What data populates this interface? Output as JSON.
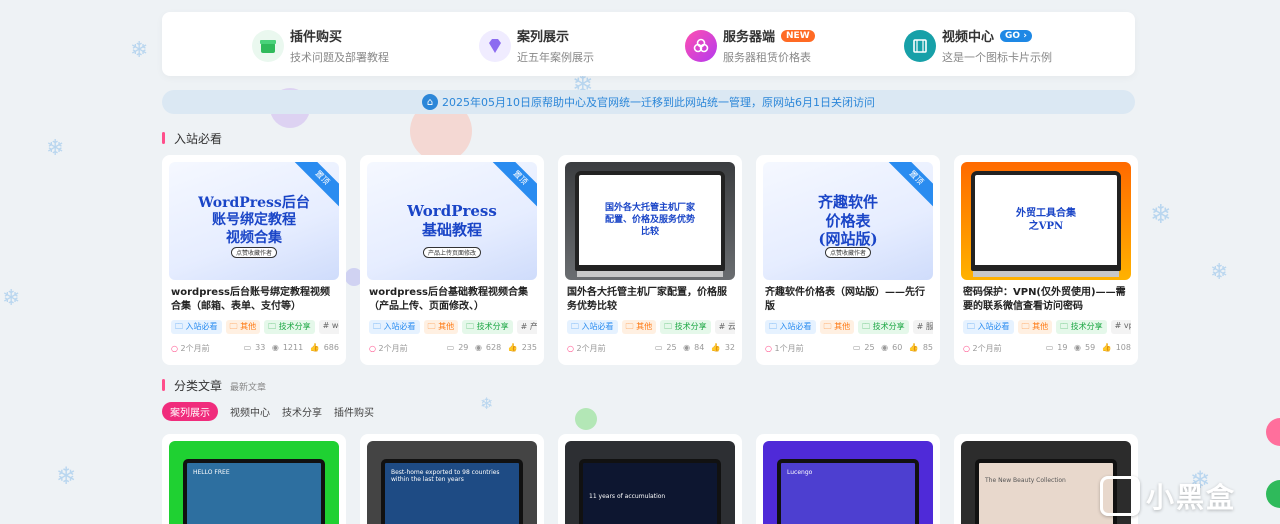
{
  "categories": [
    {
      "title": "插件购买",
      "subtitle": "技术问题及部署教程",
      "icon": "shop-icon",
      "color": "#2fba5b",
      "badge": ""
    },
    {
      "title": "案列展示",
      "subtitle": "近五年案例展示",
      "icon": "gem-icon",
      "color": "#8c6cf0",
      "badge": ""
    },
    {
      "title": "服务器端",
      "subtitle": "服务器租赁价格表",
      "icon": "cloud-icon",
      "color": "#e83ad0",
      "badge": "NEW"
    },
    {
      "title": "视频中心",
      "subtitle": "这是一个图标卡片示例",
      "icon": "film-icon",
      "color": "#17a0a8",
      "badge": "GO"
    }
  ],
  "notice": {
    "text": "2025年05月10日原帮助中心及官网统一迁移到此网站统一管理，原网站6月1日关闭访问"
  },
  "section_must_read": {
    "title": "入站必看"
  },
  "cards": [
    {
      "thumb_text": "WordPress后台\n账号绑定教程\n视频合集",
      "thumb_small": "点赞收藏作者",
      "ribbon": "置顶",
      "title": "wordpress后台账号绑定教程视频合集（邮箱、表单、支付等）",
      "tags": [
        "入站必看",
        "其他",
        "技术分享",
        "# wo"
      ],
      "time": "2个月前",
      "comments": "33",
      "views": "1211",
      "likes": "686"
    },
    {
      "thumb_text": "WordPress\n基础教程",
      "thumb_small": "产品上传页面修改",
      "ribbon": "置顶",
      "title": "wordpress后台基础教程视频合集（产品上传、页面修改、）",
      "tags": [
        "入站必看",
        "其他",
        "技术分享",
        "# 产品"
      ],
      "time": "2个月前",
      "comments": "29",
      "views": "628",
      "likes": "235"
    },
    {
      "thumb_text": "国外各大托管主机厂家\n配置、价格及服务优势\n比较",
      "thumb_small": "",
      "ribbon": "",
      "title": "国外各大托管主机厂家配置，价格服务优势比较",
      "tags": [
        "入站必看",
        "其他",
        "技术分享",
        "# 云"
      ],
      "time": "2个月前",
      "comments": "25",
      "views": "84",
      "likes": "32"
    },
    {
      "thumb_text": "齐趣软件\n价格表\n(网站版)",
      "thumb_small": "点赞收藏作者",
      "ribbon": "置顶",
      "title": "齐趣软件价格表（网站版）——先行版",
      "tags": [
        "入站必看",
        "其他",
        "技术分享",
        "# 服务"
      ],
      "time": "1个月前",
      "comments": "25",
      "views": "60",
      "likes": "85"
    },
    {
      "thumb_text": "外贸工具合集\n之VPN",
      "thumb_small": "",
      "ribbon": "",
      "title": "密码保护：VPN(仅外贸使用)——需要的联系微信查看访问密码",
      "tags": [
        "入站必看",
        "其他",
        "技术分享",
        "# vpn"
      ],
      "time": "2个月前",
      "comments": "19",
      "views": "59",
      "likes": "108"
    }
  ],
  "section_category": {
    "title": "分类文章",
    "subtitle": "最新文章"
  },
  "tabs": [
    "案列展示",
    "视频中心",
    "技术分享",
    "插件购买"
  ],
  "bottom_cards": [
    {
      "screen_text": "HELLO FREE",
      "bg": "#1fd132",
      "screen": "#2d6fa0"
    },
    {
      "screen_text": "Best-home exported to 98 countries within the last ten years",
      "bg": "#444",
      "screen": "#1e4b84"
    },
    {
      "screen_text": "11 years of accumulation",
      "bg": "#2d2f33",
      "screen": "#0d1630"
    },
    {
      "screen_text": "Lucengo",
      "bg": "#4f2ad8",
      "screen": "#4d3fd0"
    },
    {
      "screen_text": "The New Beauty Collection",
      "bg": "#2c2c2c",
      "screen": "#e8d8cc"
    }
  ],
  "watermark": {
    "text": "小黑盒"
  }
}
